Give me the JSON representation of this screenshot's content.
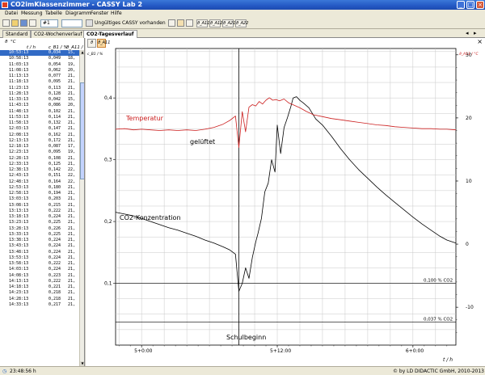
{
  "window": {
    "title": "CO2imKlassenzimmer - CASSY Lab 2"
  },
  "menu": [
    "Datei",
    "Messung",
    "Tabelle",
    "Diagramm",
    "Fenster",
    "Hilfe"
  ],
  "toolbar": {
    "measurement_select": "#1",
    "info_text": "Ungültiges CASSY vorhanden",
    "function_buttons": [
      "ϑ_A11",
      "ϑ_A12",
      "ϑ_A21",
      "ϑ_A22"
    ]
  },
  "tabs": [
    "Standard",
    "CO2-Wochenverlauf",
    "CO2-Tagesverlauf"
  ],
  "table": {
    "unit_labels": [
      "ϑ",
      "°C"
    ],
    "headers": [
      "t / h",
      "c_B1 / %",
      "ϑ_A11 /"
    ],
    "rows": [
      [
        "10:53:13",
        "0,034",
        "15,"
      ],
      [
        "10:58:13",
        "0,049",
        "18,"
      ],
      [
        "11:03:13",
        "0,054",
        "19,"
      ],
      [
        "11:08:13",
        "0,062",
        "20,"
      ],
      [
        "11:13:13",
        "0,077",
        "21,"
      ],
      [
        "11:18:13",
        "0,095",
        "21,"
      ],
      [
        "11:23:13",
        "0,113",
        "21,"
      ],
      [
        "11:28:13",
        "0,128",
        "21,"
      ],
      [
        "11:33:13",
        "0,042",
        "15,"
      ],
      [
        "11:43:13",
        "0,086",
        "20,"
      ],
      [
        "11:48:13",
        "0,102",
        "21,"
      ],
      [
        "11:53:13",
        "0,114",
        "21,"
      ],
      [
        "11:58:13",
        "0,132",
        "21,"
      ],
      [
        "12:03:13",
        "0,147",
        "21,"
      ],
      [
        "12:08:13",
        "0,162",
        "21,"
      ],
      [
        "12:13:13",
        "0,172",
        "21,"
      ],
      [
        "12:18:13",
        "0,087",
        "17,"
      ],
      [
        "12:23:13",
        "0,095",
        "19,"
      ],
      [
        "12:28:13",
        "0,108",
        "21,"
      ],
      [
        "12:33:13",
        "0,125",
        "21,"
      ],
      [
        "12:38:13",
        "0,142",
        "22,"
      ],
      [
        "12:43:13",
        "0,151",
        "22,"
      ],
      [
        "12:48:13",
        "0,164",
        "22,"
      ],
      [
        "12:53:13",
        "0,180",
        "21,"
      ],
      [
        "12:58:13",
        "0,194",
        "21,"
      ],
      [
        "13:03:13",
        "0,203",
        "21,"
      ],
      [
        "13:08:13",
        "0,215",
        "21,"
      ],
      [
        "13:13:13",
        "0,222",
        "21,"
      ],
      [
        "13:18:13",
        "0,224",
        "21,"
      ],
      [
        "13:23:13",
        "0,225",
        "21,"
      ],
      [
        "13:28:13",
        "0,226",
        "21,"
      ],
      [
        "13:33:13",
        "0,225",
        "21,"
      ],
      [
        "13:38:13",
        "0,224",
        "21,"
      ],
      [
        "13:43:13",
        "0,224",
        "21,"
      ],
      [
        "13:48:13",
        "0,224",
        "21,"
      ],
      [
        "13:53:13",
        "0,224",
        "21,"
      ],
      [
        "13:58:13",
        "0,222",
        "21,"
      ],
      [
        "14:03:13",
        "0,224",
        "21,"
      ],
      [
        "14:08:13",
        "0,223",
        "21,"
      ],
      [
        "14:13:13",
        "0,222",
        "21,"
      ],
      [
        "14:18:13",
        "0,221",
        "21,"
      ],
      [
        "14:23:13",
        "0,218",
        "21,"
      ],
      [
        "14:28:13",
        "0,218",
        "21,"
      ],
      [
        "14:33:13",
        "0,217",
        "21,"
      ]
    ]
  },
  "chart_data": {
    "type": "line",
    "xlabel": "t / h",
    "left_axis": {
      "ticks": [
        "0,1",
        "0,2",
        "0,3",
        "0,4"
      ],
      "ylim": [
        0.0,
        0.48
      ]
    },
    "right_axis": {
      "ticks": [
        "-10",
        "0",
        "10",
        "20",
        "30"
      ],
      "ylim": [
        -16,
        31
      ]
    },
    "x_ticks": [
      "5+0:00",
      "5+12:00",
      "6+0:00"
    ],
    "xlim_hours": [
      -2.3,
      27.8
    ],
    "hlines": [
      {
        "label": "0,100 % CO2",
        "value": 0.1
      },
      {
        "label": "0,037 % CO2",
        "value": 0.037
      }
    ],
    "vline_hour": 8.6,
    "annotations": [
      "Temperatur",
      "gelüftet",
      "CO2-Konzentration",
      "Schulbeginn"
    ],
    "series": [
      {
        "name": "CO2-Konzentration",
        "color": "#000000",
        "axis": "left",
        "x": [
          -2.3,
          -1.5,
          -0.7,
          0.0,
          0.8,
          1.6,
          2.4,
          3.2,
          4.0,
          4.8,
          5.6,
          6.4,
          7.2,
          7.8,
          8.3,
          8.6,
          8.9,
          9.2,
          9.5,
          9.8,
          10.1,
          10.3,
          10.6,
          10.9,
          11.2,
          11.5,
          11.8,
          12.0,
          12.3,
          12.6,
          12.9,
          13.2,
          13.4,
          13.7,
          14.0,
          14.3,
          14.8,
          15.4,
          16.0,
          16.8,
          17.6,
          18.4,
          19.2,
          20.0,
          20.8,
          21.6,
          22.4,
          23.2,
          24.0,
          24.8,
          25.6,
          26.4,
          27.0,
          27.8
        ],
        "y": [
          0.215,
          0.212,
          0.209,
          0.205,
          0.2,
          0.195,
          0.19,
          0.186,
          0.181,
          0.176,
          0.17,
          0.165,
          0.159,
          0.154,
          0.147,
          0.087,
          0.1,
          0.125,
          0.108,
          0.142,
          0.167,
          0.181,
          0.205,
          0.248,
          0.262,
          0.3,
          0.28,
          0.356,
          0.31,
          0.352,
          0.368,
          0.386,
          0.4,
          0.402,
          0.396,
          0.392,
          0.384,
          0.366,
          0.356,
          0.338,
          0.318,
          0.3,
          0.284,
          0.27,
          0.256,
          0.243,
          0.231,
          0.219,
          0.207,
          0.196,
          0.186,
          0.176,
          0.17,
          0.165
        ]
      },
      {
        "name": "Temperatur",
        "color": "#cc2020",
        "axis": "right",
        "x": [
          -2.3,
          -1.5,
          -0.7,
          0.0,
          0.8,
          1.6,
          2.4,
          3.2,
          4.0,
          4.8,
          5.6,
          6.4,
          7.2,
          7.8,
          8.3,
          8.6,
          8.9,
          9.2,
          9.5,
          9.8,
          10.1,
          10.4,
          10.7,
          11.0,
          11.3,
          11.6,
          11.9,
          12.2,
          12.6,
          13.0,
          13.5,
          14.0,
          14.6,
          15.2,
          16.0,
          16.8,
          17.6,
          18.4,
          19.2,
          20.0,
          20.8,
          21.6,
          22.4,
          23.2,
          24.0,
          24.8,
          25.6,
          26.4,
          27.0,
          27.8
        ],
        "y": [
          18.2,
          18.3,
          18.1,
          18.2,
          18.1,
          18.0,
          18.1,
          18.0,
          18.1,
          18.0,
          18.2,
          18.5,
          19.0,
          19.6,
          20.3,
          15.3,
          21.0,
          17.8,
          21.7,
          22.1,
          21.9,
          22.6,
          22.2,
          22.8,
          23.2,
          22.8,
          22.9,
          22.7,
          23.0,
          22.4,
          22.0,
          21.6,
          21.0,
          20.5,
          20.2,
          19.9,
          19.7,
          19.5,
          19.3,
          19.1,
          18.9,
          18.8,
          18.6,
          18.5,
          18.4,
          18.3,
          18.3,
          18.2,
          18.2,
          18.1
        ]
      }
    ]
  },
  "status": {
    "time": "23:48:56 h",
    "copyright": "© by LD DIDACTIC GmbH, 2010-2013"
  }
}
